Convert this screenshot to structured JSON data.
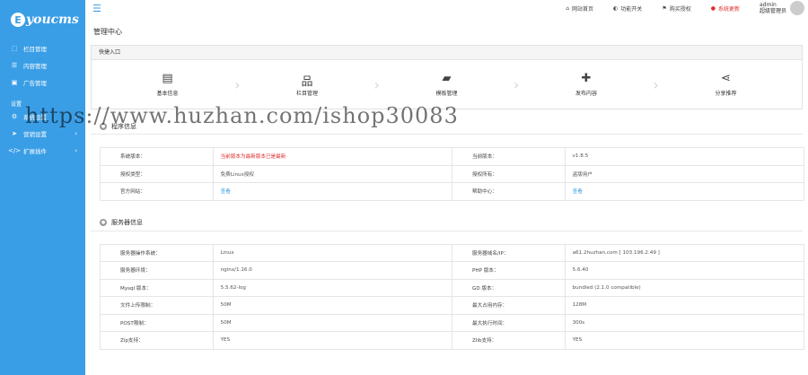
{
  "brand": {
    "logo_letter": "E",
    "logo_text": "youcms"
  },
  "sidebar": {
    "items": [
      {
        "icon": "sitemap-icon",
        "glyph": "⬚",
        "label": "栏目管理"
      },
      {
        "icon": "list-icon",
        "glyph": "☰",
        "label": "内容管理"
      },
      {
        "icon": "image-icon",
        "glyph": "▣",
        "label": "广告管理"
      }
    ],
    "section_label": "设置",
    "items2": [
      {
        "icon": "gear-icon",
        "glyph": "⚙",
        "label": "系统设置",
        "arrow": "›"
      },
      {
        "icon": "send-icon",
        "glyph": "➤",
        "label": "营销设置",
        "arrow": "›"
      },
      {
        "icon": "code-icon",
        "glyph": "</>",
        "label": "扩展插件",
        "arrow": "›"
      }
    ]
  },
  "topbar": {
    "menu_icon": "☰",
    "links": [
      {
        "icon": "home-icon",
        "glyph": "⌂",
        "label": "网站首页"
      },
      {
        "icon": "toggle-icon",
        "glyph": "◐",
        "label": "功能开关"
      },
      {
        "icon": "flag-icon",
        "glyph": "⚑",
        "label": "购买授权"
      },
      {
        "icon": "alert-icon",
        "glyph": "●",
        "label": "系统更新",
        "alert": true
      }
    ],
    "user": {
      "name": "admin",
      "role": "超级管理员"
    }
  },
  "main": {
    "title": "管理中心",
    "quick_title": "快捷入口",
    "quick_items": [
      {
        "icon": "id-card-icon",
        "glyph": "▤",
        "label": "基本信息"
      },
      {
        "icon": "sitemap-icon",
        "glyph": "品",
        "label": "栏目管理"
      },
      {
        "icon": "folder-icon",
        "glyph": "▰",
        "label": "模板管理"
      },
      {
        "icon": "plus-icon",
        "glyph": "✚",
        "label": "发布内容"
      },
      {
        "icon": "share-icon",
        "glyph": "⋖",
        "label": "分享推荐"
      }
    ],
    "program": {
      "title": "程序信息",
      "rows": [
        [
          "系统版本：",
          "当前版本为最新版本已是最新",
          "当前版本：",
          "v1.8.5"
        ],
        [
          "授权类型：",
          "免费Linux授权",
          "授权所有：",
          "盗版用户"
        ],
        [
          "官方网站：",
          "查看",
          "帮助中心：",
          "查看"
        ]
      ]
    },
    "server": {
      "title": "服务器信息",
      "rows": [
        [
          "服务器操作系统：",
          "Linux",
          "服务器域名/IP：",
          "a61.2huzhan.com [ 103.196.2.49 ]"
        ],
        [
          "服务器环境：",
          "nginx/1.16.0",
          "PHP 版本：",
          "5.6.40"
        ],
        [
          "Mysql 版本：",
          "5.5.62-log",
          "GD 版本：",
          "bundled (2.1.0 compatible)"
        ],
        [
          "文件上传限制：",
          "50M",
          "最大占用内存：",
          "128M"
        ],
        [
          "POST限制：",
          "50M",
          "最大执行时间：",
          "300s"
        ],
        [
          "Zip支持：",
          "YES",
          "Zlib支持：",
          "YES"
        ]
      ]
    }
  },
  "watermark": "https://www.huzhan.com/ishop30083",
  "colors": {
    "accent": "#3a9ee6",
    "alert": "#e02b2b"
  }
}
